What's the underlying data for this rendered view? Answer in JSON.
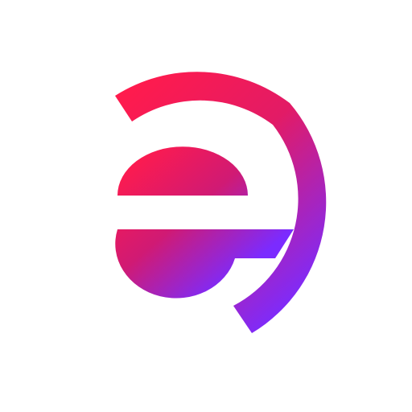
{
  "logo": {
    "icon": "e-swirl-logo-icon",
    "colors": {
      "gradient_start": "#FF1B4D",
      "gradient_end": "#7B2BFF",
      "background": "#FFFFFF"
    }
  }
}
